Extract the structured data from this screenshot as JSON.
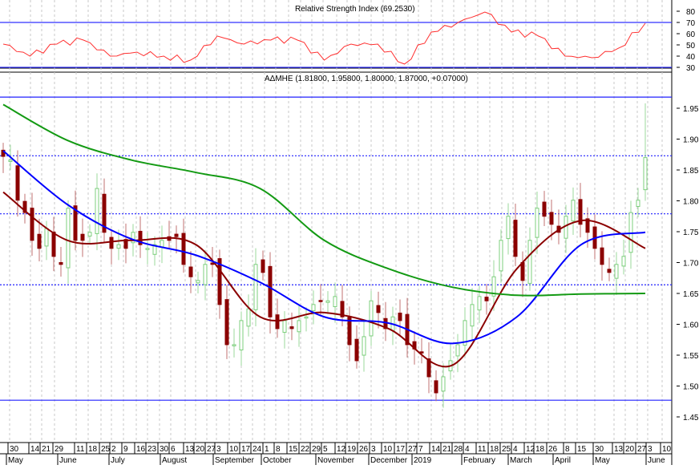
{
  "chart_data": {
    "type": "candlestick",
    "rsi_panel": {
      "title": "Relative Strength Index (69.2530)",
      "yticks": [
        "80",
        "70",
        "60",
        "50",
        "40",
        "30"
      ],
      "ylim": [
        30,
        80
      ],
      "bands": [
        70,
        30
      ],
      "values": [
        50.7,
        40,
        50.7,
        54.3,
        40,
        43.6,
        40,
        36.4,
        57.9,
        50.7,
        54.3,
        54.3,
        36.4,
        50.7,
        50.7,
        32.9,
        61.4,
        70,
        79.3,
        61.4,
        57.9,
        40,
        38.6,
        47.1,
        69.3
      ],
      "line_color": "#ff3030"
    },
    "price_panel": {
      "title": "ΑΔΜΗΕ (1.81800, 1.95800, 1.80000, 1.87000, +0.07000)",
      "yticks": [
        "1.95",
        "1.90",
        "1.85",
        "1.80",
        "1.75",
        "1.70",
        "1.65",
        "1.60",
        "1.55",
        "1.50",
        "1.45"
      ],
      "ylim": [
        1.44,
        1.99
      ],
      "last_bar": {
        "open": 1.818,
        "high": 1.958,
        "low": 1.8,
        "close": 1.87,
        "change": 0.07
      },
      "closes": [
        1.872,
        1.866,
        1.801,
        1.781,
        1.736,
        1.723,
        1.755,
        1.71,
        1.697,
        1.788,
        1.736,
        1.736,
        1.749,
        1.82,
        1.749,
        1.723,
        1.729,
        1.723,
        1.749,
        1.729,
        1.723,
        1.729,
        1.736,
        1.736,
        1.742,
        1.697,
        1.677,
        1.671,
        1.697,
        1.697,
        1.632,
        1.567,
        1.567,
        1.606,
        1.625,
        1.697,
        1.684,
        1.612,
        1.593,
        1.606,
        1.593,
        1.606,
        1.612,
        1.632,
        1.638,
        1.638,
        1.645,
        1.612,
        1.567,
        1.541,
        1.58,
        1.638,
        1.619,
        1.593,
        1.612,
        1.606,
        1.567,
        1.56,
        1.554,
        1.515,
        1.489,
        1.515,
        1.541,
        1.567,
        1.606,
        1.632,
        1.645,
        1.638,
        1.677,
        1.736,
        1.775,
        1.71,
        1.671,
        1.736,
        1.788,
        1.775,
        1.762,
        1.749,
        1.775,
        1.801,
        1.762,
        1.749,
        1.723,
        1.697,
        1.684,
        1.697,
        1.71,
        1.781,
        1.801,
        1.87
      ],
      "moving_averages": [
        {
          "name": "MA short",
          "color": "#8b0000",
          "values": [
            1.814,
            1.736,
            1.736,
            1.729,
            1.612,
            1.619,
            1.593,
            1.534,
            1.69,
            1.768,
            1.723
          ]
        },
        {
          "name": "MA medium",
          "color": "#0000ff",
          "values": [
            1.881,
            1.794,
            1.738,
            1.712,
            1.668,
            1.612,
            1.602,
            1.569,
            1.612,
            1.729,
            1.749
          ]
        },
        {
          "name": "MA long",
          "color": "#139a13",
          "values": [
            1.956,
            1.898,
            1.866,
            1.846,
            1.82,
            1.736,
            1.69,
            1.66,
            1.647,
            1.649,
            1.65
          ]
        }
      ],
      "horizontal_lines": [
        {
          "value": 1.968,
          "style": "solid"
        },
        {
          "value": 1.873,
          "style": "dotted"
        },
        {
          "value": 1.779,
          "style": "dotted"
        },
        {
          "value": 1.664,
          "style": "dotted"
        },
        {
          "value": 1.477,
          "style": "solid"
        }
      ],
      "up_color": "#7ccf7c",
      "down_color": "#8b0000"
    },
    "x_axis": {
      "day_ticks": [
        "30",
        "14",
        "21",
        "29",
        "11",
        "18",
        "25",
        "2",
        "9",
        "16",
        "23",
        "30",
        "6",
        "13",
        "20",
        "27",
        "3",
        "10",
        "17",
        "24",
        "1",
        "8",
        "15",
        "22",
        "29",
        "5",
        "12",
        "19",
        "26",
        "3",
        "10",
        "17",
        "27",
        "7",
        "14",
        "21",
        "28",
        "4",
        "11",
        "18",
        "25",
        "4",
        "12",
        "18",
        "26",
        "8",
        "15",
        "30",
        "13",
        "20",
        "27",
        "3",
        "10"
      ],
      "month_labels": [
        "May",
        "June",
        "July",
        "August",
        "September",
        "October",
        "November",
        "December",
        "2019",
        "February",
        "March",
        "April",
        "May",
        "June"
      ]
    }
  }
}
